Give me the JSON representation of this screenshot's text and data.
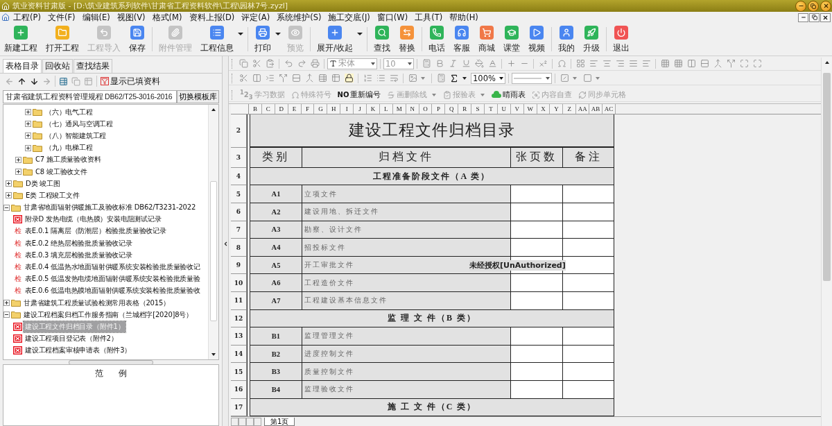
{
  "window": {
    "title": "筑业资料甘肃版 - [D:\\筑业建筑系列软件\\甘肃省工程资料软件\\工程\\园林7号.zyzl]"
  },
  "menu": [
    "工程(P)",
    "文件(F)",
    "编辑(E)",
    "视图(V)",
    "格式(M)",
    "资料上报(D)",
    "评定(A)",
    "系统维护(S)",
    "施工交底(J)",
    "窗口(W)",
    "工具(T)",
    "帮助(H)"
  ],
  "toolbar": [
    [
      {
        "label": "新建工程",
        "disabled": false,
        "dropdown": false
      },
      {
        "label": "打开工程",
        "disabled": false,
        "dropdown": false
      },
      {
        "label": "工程导入",
        "disabled": true,
        "dropdown": false
      },
      {
        "label": "保存",
        "disabled": false,
        "dropdown": false
      }
    ],
    [
      {
        "label": "附件管理",
        "disabled": true,
        "dropdown": false
      },
      {
        "label": "工程信息",
        "disabled": false,
        "dropdown": true
      }
    ],
    [
      {
        "label": "打印",
        "disabled": false,
        "dropdown": true
      },
      {
        "label": "预览",
        "disabled": true,
        "dropdown": false
      }
    ],
    [
      {
        "label": "展开/收起",
        "disabled": false,
        "dropdown": true
      }
    ],
    [
      {
        "label": "查找",
        "disabled": false,
        "dropdown": false
      },
      {
        "label": "替换",
        "disabled": false,
        "dropdown": false
      }
    ],
    [
      {
        "label": "电话",
        "disabled": false,
        "dropdown": false
      },
      {
        "label": "客服",
        "disabled": false,
        "dropdown": false
      },
      {
        "label": "商城",
        "disabled": false,
        "dropdown": false
      },
      {
        "label": "课堂",
        "disabled": false,
        "dropdown": false
      },
      {
        "label": "视频",
        "disabled": false,
        "dropdown": false
      }
    ],
    [
      {
        "label": "我的",
        "disabled": false,
        "dropdown": false
      },
      {
        "label": "升级",
        "disabled": false,
        "dropdown": false
      }
    ],
    [
      {
        "label": "退出",
        "disabled": false,
        "dropdown": false
      }
    ]
  ],
  "left_panel": {
    "tabs": [
      {
        "label": "表格目录",
        "selected": true
      },
      {
        "label": "回收站",
        "selected": false
      },
      {
        "label": "查找结果",
        "selected": false
      }
    ],
    "nav": [
      {
        "disabled": true
      },
      {
        "disabled": false
      },
      {
        "disabled": false
      },
      {
        "disabled": true
      }
    ],
    "tools": [
      {
        "disabled": false
      },
      {
        "disabled": true
      },
      {
        "disabled": true
      }
    ],
    "show_filled": "显示已填资料",
    "template": {
      "value": "甘肃省建筑工程资料管理规程 DB62/T25-3016-2016",
      "button": "切换模板库"
    },
    "tree": [
      {
        "children": [
          {
            "children": [
              {
                "children": [
                  {
                    "label": "（六）电气工程",
                    "kind": "folder",
                    "expanded": false,
                    "selected": false
                  },
                  {
                    "label": "（七）通风与空调工程",
                    "kind": "folder",
                    "expanded": false,
                    "selected": false
                  },
                  {
                    "label": "（八）智能建筑工程",
                    "kind": "folder",
                    "expanded": false,
                    "selected": false
                  },
                  {
                    "label": "（九）电梯工程",
                    "kind": "folder",
                    "expanded": false,
                    "selected": false
                  }
                ]
              },
              {
                "label": "C7 施工质量验收资料",
                "kind": "folder",
                "expanded": false,
                "selected": false
              },
              {
                "label": "C8 竣工验收文件",
                "kind": "folder",
                "expanded": false,
                "selected": false
              }
            ]
          },
          {
            "label": "D类 竣工图",
            "kind": "folder",
            "expanded": false,
            "selected": false
          },
          {
            "label": "E类 工程竣工文件",
            "kind": "folder",
            "expanded": false,
            "selected": false
          }
        ]
      },
      {
        "label": "甘肃省地面辐射供暖施工及验收标准 DB62/T3231-2022",
        "kind": "folder",
        "expanded": true,
        "selected": false,
        "children": [
          {
            "label": "附录D 发热电缆（电热膜）安装电阻测试记录",
            "kind": "form",
            "selected": false
          },
          {
            "label": "表E.0.1 隔离层（防潮层）检验批质量验收记录",
            "kind": "check",
            "badge": "检",
            "selected": false
          },
          {
            "label": "表E.0.2 绝热层检验批质量验收记录",
            "kind": "check",
            "badge": "检",
            "selected": false
          },
          {
            "label": "表E.0.3 填充层检验批质量验收记录",
            "kind": "check",
            "badge": "检",
            "selected": false
          },
          {
            "label": "表E.0.4 低温热水地面辐射供暖系统安装检验批质量验收记",
            "kind": "check",
            "badge": "检",
            "selected": false
          },
          {
            "label": "表E.0.5 低温发热电缆地面辐射供暖系统安装检验批质量验",
            "kind": "check",
            "badge": "检",
            "selected": false
          },
          {
            "label": "表E.0.6 低温电热膜地面辐射供暖系统安装检验批质量验收",
            "kind": "check",
            "badge": "检",
            "selected": false
          }
        ]
      },
      {
        "label": "甘肃省建筑工程质量试验检测常用表格（2015）",
        "kind": "folder",
        "expanded": false,
        "selected": false
      },
      {
        "label": "建设工程档案归档工作服务指南（兰城档字[2020]8号）",
        "kind": "folder",
        "expanded": true,
        "selected": false,
        "children": [
          {
            "label": "建设工程文件归档目录（附件1）",
            "kind": "form",
            "selected": true
          },
          {
            "label": "建设工程项目登记表（附件2）",
            "kind": "form",
            "selected": false
          },
          {
            "label": "建设工程档案审核申请表（附件3）",
            "kind": "form",
            "selected": false
          }
        ]
      }
    ],
    "example_title": "范      例"
  },
  "format_bar": {
    "font": {
      "value": "宋体",
      "disabled": true
    },
    "size": {
      "value": "10",
      "disabled": true
    },
    "zoom": {
      "value": "100%",
      "disabled": false
    },
    "buttons": [
      {
        "icon_text": "$^{1}$2$_{3}$",
        "label": "学习数据",
        "disabled": true,
        "dropdown": false
      },
      {
        "label": "特殊符号",
        "disabled": true,
        "dropdown": false
      },
      {
        "icon_text": "NO",
        "label": "重新编号",
        "disabled": false,
        "dropdown": false
      },
      {
        "label": "画删除线",
        "disabled": true,
        "dropdown": true
      },
      {
        "label": "报验表",
        "disabled": true,
        "dropdown": true
      },
      {
        "label": "晴雨表",
        "disabled": false,
        "dropdown": false
      },
      {
        "label": "内容自查",
        "disabled": true,
        "dropdown": false
      },
      {
        "label": "同步单元格",
        "disabled": true,
        "dropdown": false
      }
    ]
  },
  "sheet": {
    "columns": [
      "B",
      "C",
      "D",
      "E",
      "F",
      "G",
      "H",
      "I",
      "J",
      "K",
      "L",
      "M",
      "N",
      "O",
      "P",
      "Q",
      "R",
      "S",
      "T",
      "U",
      "V",
      "W",
      "X",
      "Y",
      "Z",
      "AA",
      "AB",
      "AC"
    ],
    "title_row": "2",
    "title": "建设工程文件归档目录",
    "header_row": "3",
    "headers": [
      "类别",
      "归档文件",
      "张页数",
      "备注"
    ],
    "rows": [
      {
        "num": "4",
        "kind": "section",
        "text": "工程准备阶段文件（A 类）"
      },
      {
        "num": "5",
        "kind": "item",
        "code": "A1",
        "name": "立项文件"
      },
      {
        "num": "6",
        "kind": "item",
        "code": "A2",
        "name": "建设用地、拆迁文件"
      },
      {
        "num": "7",
        "kind": "item",
        "code": "A3",
        "name": "勘察、设计文件"
      },
      {
        "num": "8",
        "kind": "item",
        "code": "A4",
        "name": "招投标文件"
      },
      {
        "num": "9",
        "kind": "item",
        "code": "A5",
        "name": "开工审批文件",
        "overlay": "未经授权[UnAuthorized]"
      },
      {
        "num": "10",
        "kind": "item",
        "code": "A6",
        "name": "工程造价文件"
      },
      {
        "num": "11",
        "kind": "item",
        "code": "A7",
        "name": "工程建设基本信息文件"
      },
      {
        "num": "12",
        "kind": "section",
        "text": "监 理 文 件（B 类）"
      },
      {
        "num": "13",
        "kind": "item",
        "code": "B1",
        "name": "监理管理文件"
      },
      {
        "num": "14",
        "kind": "item",
        "code": "B2",
        "name": "进度控制文件"
      },
      {
        "num": "15",
        "kind": "item",
        "code": "B3",
        "name": "质量控制文件"
      },
      {
        "num": "16",
        "kind": "item",
        "code": "B4",
        "name": "监理验收文件"
      },
      {
        "num": "17",
        "kind": "section",
        "text": "施 工 文 件（C 类）"
      }
    ],
    "tabs": [
      {
        "label": "第1页",
        "selected": true
      }
    ]
  }
}
